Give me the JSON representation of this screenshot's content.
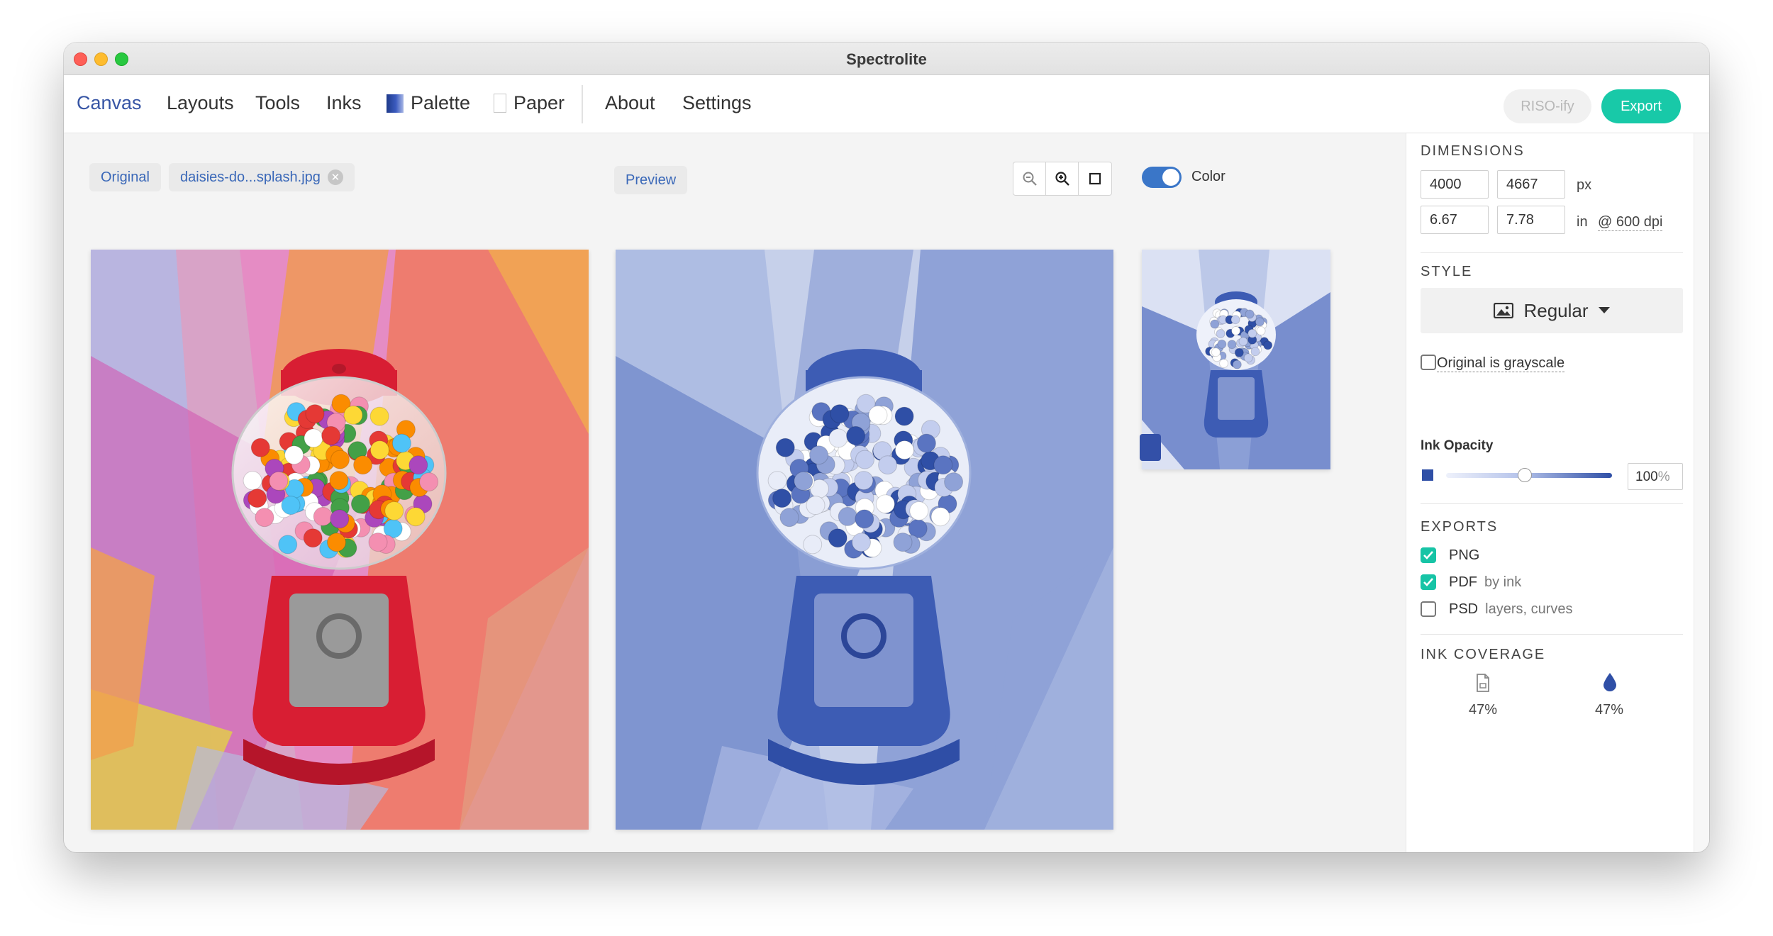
{
  "window": {
    "title": "Spectrolite"
  },
  "nav": {
    "tabs": [
      {
        "label": "Canvas"
      },
      {
        "label": "Layouts"
      },
      {
        "label": "Tools"
      },
      {
        "label": "Inks"
      },
      {
        "label": "Palette"
      },
      {
        "label": "Paper"
      },
      {
        "label": "About"
      },
      {
        "label": "Settings"
      }
    ],
    "active_tab": "Canvas",
    "riso_label": "RISO-ify",
    "export_label": "Export"
  },
  "canvas": {
    "original_label": "Original",
    "filename": "daisies-do...splash.jpg",
    "preview_label": "Preview",
    "color_toggle": {
      "label": "Color",
      "on": true
    },
    "ink_color": "#3350a8"
  },
  "sidebar": {
    "dimensions": {
      "heading": "DIMENSIONS",
      "width_px": "4000",
      "height_px": "4667",
      "px_unit": "px",
      "width_in": "6.67",
      "height_in": "7.78",
      "in_unit": "in",
      "dpi": "@ 600 dpi"
    },
    "style": {
      "heading": "STYLE",
      "value": "Regular",
      "grayscale_label": "Original is grayscale",
      "grayscale_checked": false
    },
    "ink_opacity": {
      "label": "Ink Opacity",
      "value": "100",
      "unit": "%",
      "fraction": 0.52
    },
    "exports": {
      "heading": "EXPORTS",
      "items": [
        {
          "label": "PNG",
          "sub": "",
          "checked": true
        },
        {
          "label": "PDF",
          "sub": "by ink",
          "checked": true
        },
        {
          "label": "PSD",
          "sub": "layers, curves",
          "checked": false
        }
      ]
    },
    "ink_coverage": {
      "heading": "INK COVERAGE",
      "page_value": "47%",
      "ink_value": "47%"
    }
  },
  "colors": {
    "accent": "#18c9a8",
    "active_tab": "#3755a5",
    "ink_blue": "#3350a8"
  }
}
